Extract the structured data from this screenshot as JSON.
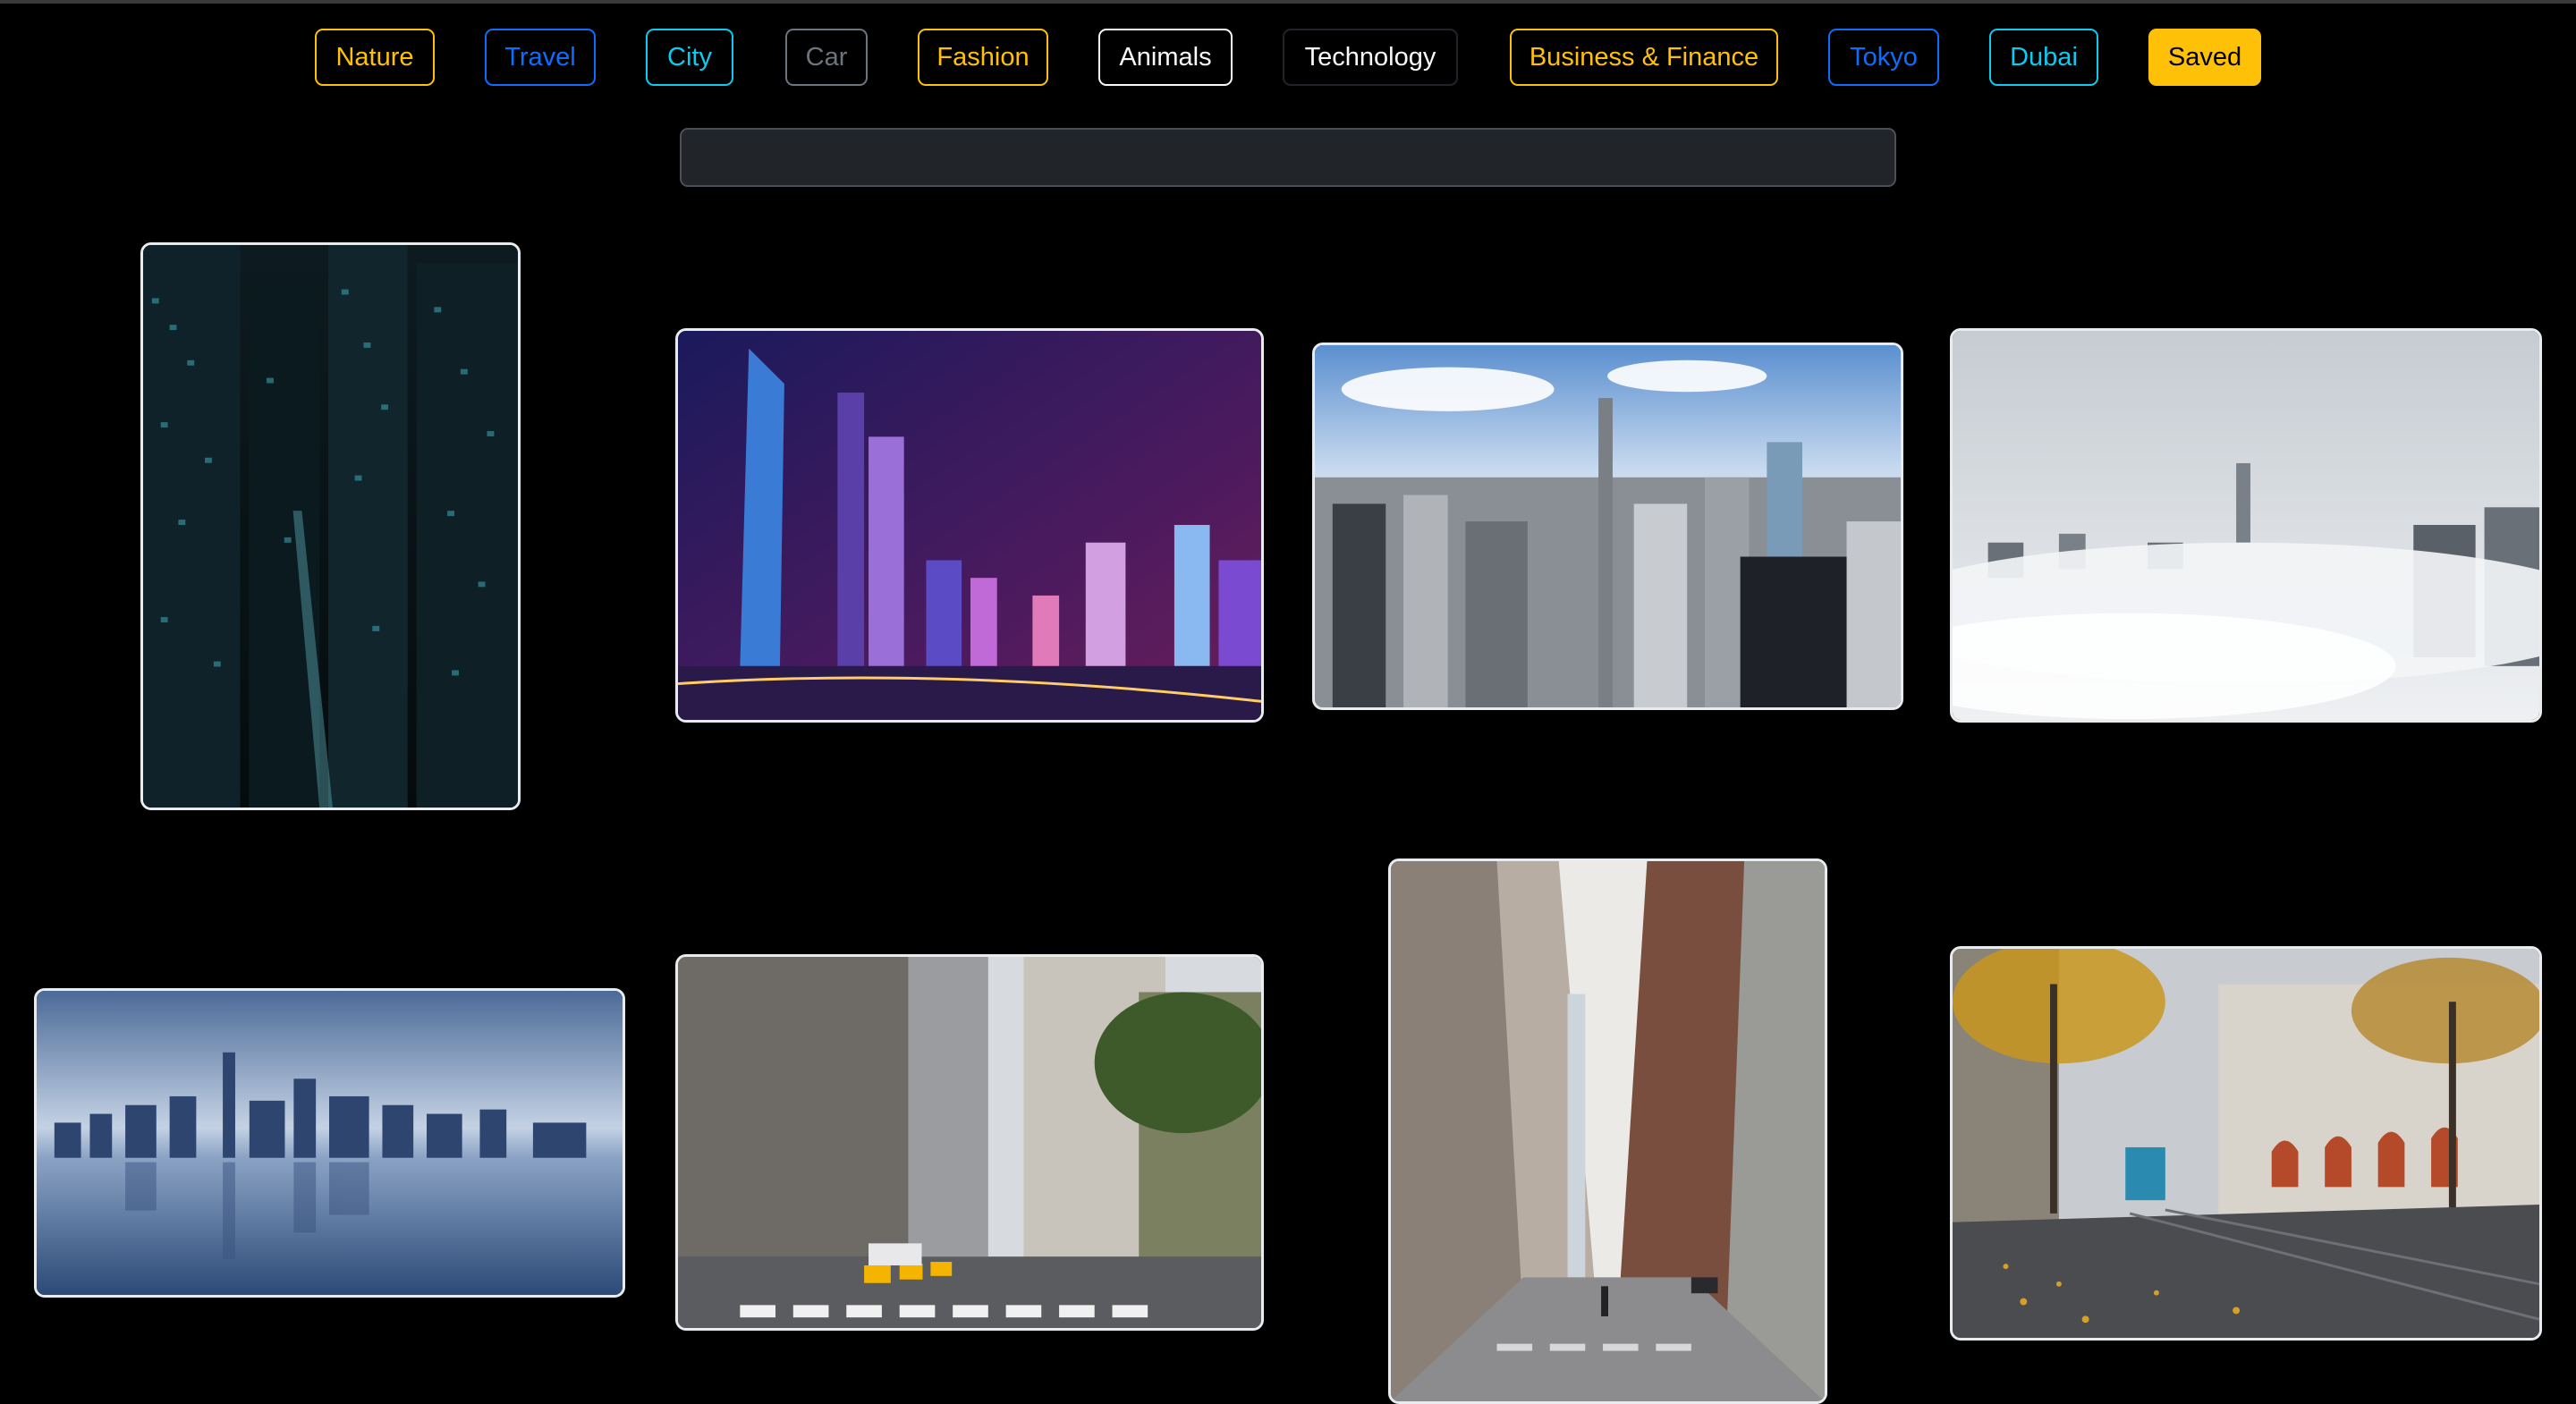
{
  "filters": [
    {
      "label": "Nature",
      "color": "#ffc107"
    },
    {
      "label": "Travel",
      "color": "#0d6efd"
    },
    {
      "label": "City",
      "color": "#0dcaf0"
    },
    {
      "label": "Car",
      "color": "#6c757d"
    },
    {
      "label": "Fashion",
      "color": "#ffc107"
    },
    {
      "label": "Animals",
      "color": "#f8f9fa"
    },
    {
      "label": "Technology",
      "color": "#212529"
    },
    {
      "label": "Business & Finance",
      "color": "#ffc107"
    },
    {
      "label": "Tokyo",
      "color": "#0d6efd"
    },
    {
      "label": "Dubai",
      "color": "#0dcaf0"
    },
    {
      "label": "Saved",
      "color": "#ffc107",
      "active": true
    }
  ],
  "search": {
    "value": "",
    "placeholder": ""
  },
  "gallery": [
    {
      "name": "city-image-dark-skyscrapers"
    },
    {
      "name": "city-image-night-skyline"
    },
    {
      "name": "city-image-aerial-manhattan"
    },
    {
      "name": "city-image-towers-in-fog"
    },
    {
      "name": "city-image-skyline-reflection"
    },
    {
      "name": "city-image-avenue-crosswalk"
    },
    {
      "name": "city-image-street-canyon"
    },
    {
      "name": "city-image-tram-autumn-street"
    }
  ]
}
